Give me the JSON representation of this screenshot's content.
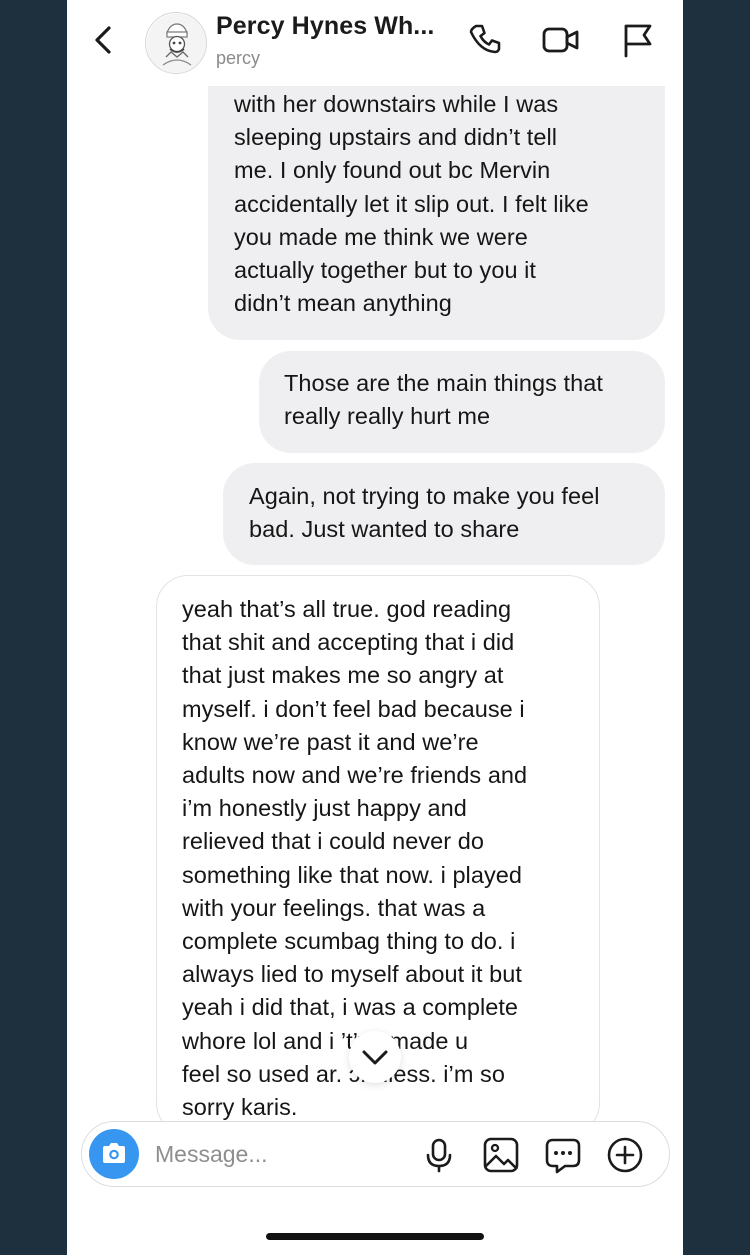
{
  "header": {
    "name": "Percy Hynes Wh...",
    "username": "percy"
  },
  "messages": [
    {
      "direction": "sent",
      "text": "with her downstairs while I was\nsleeping upstairs and didn’t tell\nme. I only found out bc Mervin\naccidentally let it slip out. I felt like\nyou made me think we were\nactually together but to you it\ndidn’t mean anything"
    },
    {
      "direction": "sent",
      "text": "Those are the main things that\nreally really hurt me"
    },
    {
      "direction": "sent",
      "text": "Again, not trying to make you feel\nbad. Just wanted to share"
    },
    {
      "direction": "received",
      "text": "yeah that’s all true. god reading\nthat shit and accepting that i did\nthat just makes me so angry at\nmyself. i don’t feel bad because i\nknow we’re past it and we’re\nadults now and we’re friends and\ni’m honestly just happy and\nrelieved that i could never do\nsomething like that now. i played\nwith your feelings. that was a\ncomplete scumbag thing to do. i\nalways lied to myself about it but\nyeah i did that, i was a complete\nwhore lol and i    ’t’ve made u\nfeel so used ar.    ɔrthless. i’m so\nsorry karis."
    }
  ],
  "composer": {
    "placeholder": "Message..."
  },
  "colors": {
    "accent": "#3797f0",
    "sent_bubble": "#efeff1",
    "background": "#1e2f3d"
  },
  "icons": [
    "back-icon",
    "phone-icon",
    "video-icon",
    "flag-icon",
    "camera-icon",
    "microphone-icon",
    "gallery-icon",
    "sticker-icon",
    "plus-icon",
    "chevron-down-icon"
  ]
}
